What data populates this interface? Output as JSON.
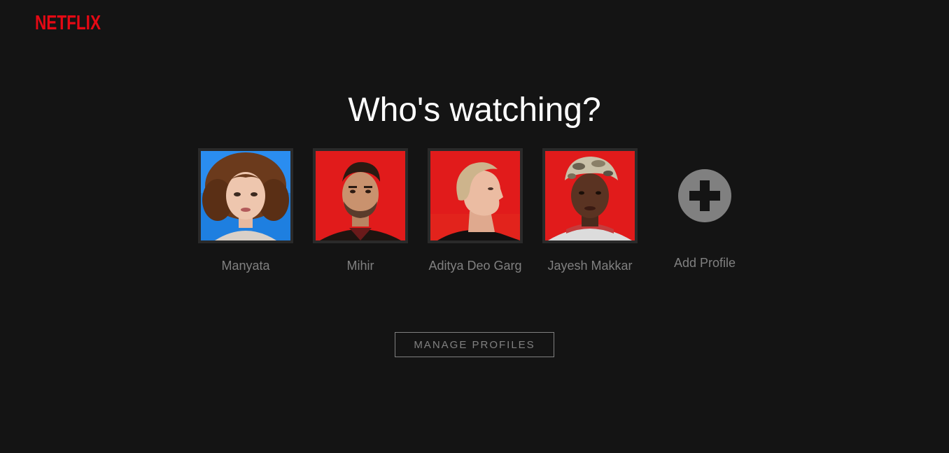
{
  "brand": {
    "logo_text": "NETFLIX",
    "color": "#e50914"
  },
  "heading": "Who's watching?",
  "profiles": [
    {
      "name": "Manyata",
      "avatar_bg": "#1e7fe0"
    },
    {
      "name": "Mihir",
      "avatar_bg": "#e11b1b"
    },
    {
      "name": "Aditya Deo Garg",
      "avatar_bg": "#e11b1b"
    },
    {
      "name": "Jayesh Makkar",
      "avatar_bg": "#e11b1b"
    }
  ],
  "add_profile": {
    "label": "Add Profile",
    "icon": "plus-circle-icon"
  },
  "manage_button": "MANAGE PROFILES",
  "colors": {
    "background": "#141414",
    "muted_text": "#808080"
  }
}
